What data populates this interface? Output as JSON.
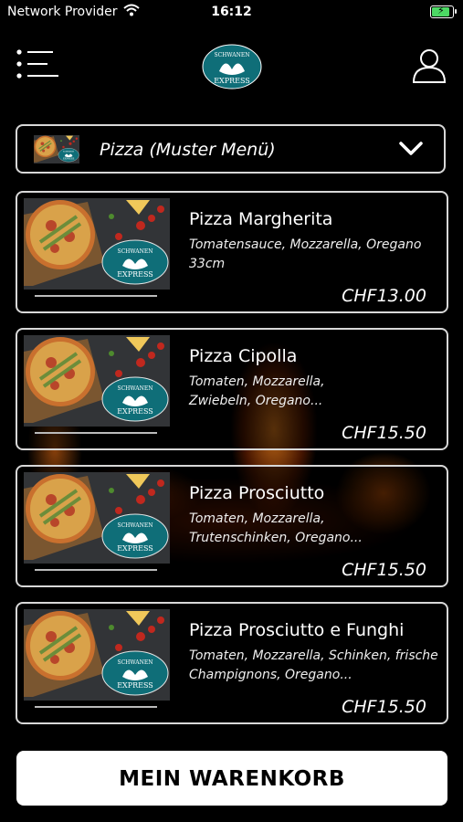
{
  "status_bar": {
    "carrier": "Network Provider",
    "time": "16:12"
  },
  "header": {
    "logo_text_top": "SCHWANEN",
    "logo_text_bottom": "EXPRESS"
  },
  "category": {
    "selected": "Pizza (Muster Menü)"
  },
  "products": [
    {
      "name": "Pizza Margherita",
      "description": "Tomatensauce, Mozzarella, Oregano 33cm",
      "price": "CHF13.00"
    },
    {
      "name": "Pizza Cipolla",
      "description": "Tomaten, Mozzarella, Zwiebeln, Oregano...",
      "price": "CHF15.50"
    },
    {
      "name": "Pizza Prosciutto",
      "description": "Tomaten, Mozzarella, Trutenschinken, Oregano...",
      "price": "CHF15.50"
    },
    {
      "name": "Pizza Prosciutto e Funghi",
      "description": "Tomaten, Mozzarella, Schinken, frische Champignons, Oregano...",
      "price": "CHF15.50"
    }
  ],
  "cart_button": {
    "label": "MEIN WARENKORB"
  },
  "colors": {
    "background": "#000000",
    "logo_teal": "#0f6e78",
    "battery_green": "#4cd964",
    "border": "#d8d8d8"
  }
}
